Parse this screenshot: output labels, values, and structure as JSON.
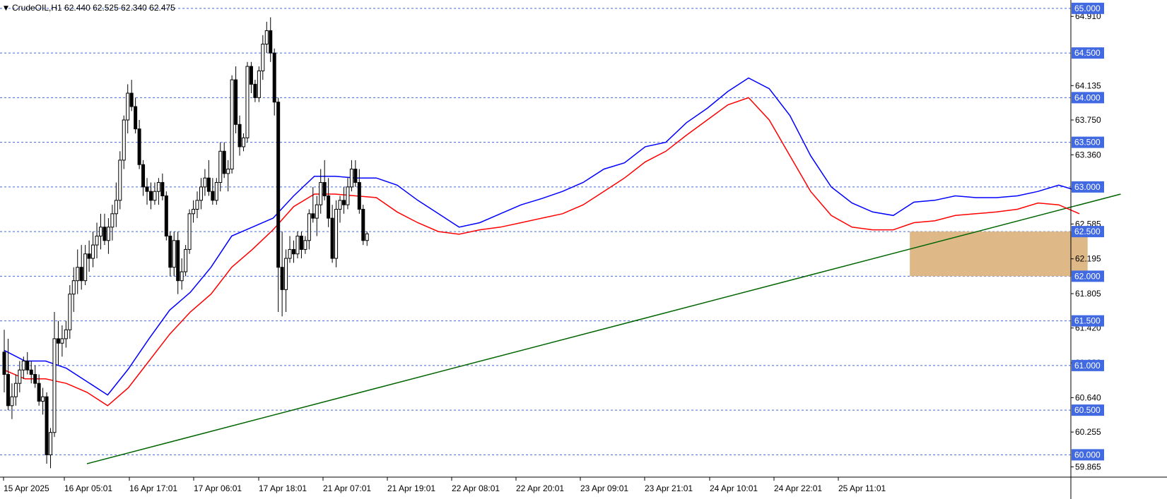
{
  "symbol_header": {
    "marker": "▼",
    "text": "CrudeOIL,H1  62.440 62.525 62.340 62.475"
  },
  "chart_data": {
    "type": "candlestick",
    "symbol": "CrudeOIL",
    "timeframe": "H1",
    "ohlc_last": {
      "open": 62.44,
      "high": 62.525,
      "low": 62.34,
      "close": 62.475
    },
    "ylim": [
      59.75,
      65.07
    ],
    "y_ticks": [
      "64.910",
      "64.135",
      "63.750",
      "63.360",
      "62.585",
      "62.195",
      "61.805",
      "61.420",
      "61.030",
      "60.640",
      "60.255",
      "59.865"
    ],
    "x_ticks": [
      "15 Apr 2025",
      "16 Apr 05:01",
      "16 Apr 17:01",
      "17 Apr 06:01",
      "17 Apr 18:01",
      "21 Apr 07:01",
      "21 Apr 19:01",
      "22 Apr 08:01",
      "22 Apr 20:01",
      "23 Apr 09:01",
      "23 Apr 21:01",
      "24 Apr 10:01",
      "24 Apr 22:01",
      "25 Apr 11:01"
    ],
    "horizontal_levels": [
      65.0,
      64.5,
      64.0,
      63.5,
      63.0,
      62.5,
      62.0,
      61.5,
      61.0,
      60.5,
      60.0
    ],
    "level_labels": [
      "65.000",
      "64.500",
      "64.000",
      "63.500",
      "63.000",
      "62.500",
      "62.000",
      "61.500",
      "61.000",
      "60.500",
      "60.000"
    ],
    "colors": {
      "bull": "#ffffff",
      "bear": "#000000",
      "ema_fast": "#0000ff",
      "ema_slow": "#ff0000",
      "trendline": "#006400",
      "zone": "#deb887",
      "grid": "#4169e1"
    },
    "ema_fast": [
      [
        0,
        61.17
      ],
      [
        5,
        61.05
      ],
      [
        10,
        61.05
      ],
      [
        15,
        60.97
      ],
      [
        20,
        60.82
      ],
      [
        25,
        60.67
      ],
      [
        30,
        60.96
      ],
      [
        35,
        61.3
      ],
      [
        40,
        61.62
      ],
      [
        45,
        61.82
      ],
      [
        50,
        62.1
      ],
      [
        55,
        62.45
      ],
      [
        60,
        62.55
      ],
      [
        65,
        62.65
      ],
      [
        70,
        62.9
      ],
      [
        75,
        63.12
      ],
      [
        80,
        63.12
      ],
      [
        85,
        63.1
      ],
      [
        90,
        63.1
      ],
      [
        95,
        63.02
      ],
      [
        100,
        62.85
      ],
      [
        105,
        62.7
      ],
      [
        110,
        62.55
      ],
      [
        115,
        62.6
      ],
      [
        120,
        62.7
      ],
      [
        125,
        62.8
      ],
      [
        130,
        62.87
      ],
      [
        135,
        62.95
      ],
      [
        140,
        63.05
      ],
      [
        145,
        63.2
      ],
      [
        150,
        63.27
      ],
      [
        155,
        63.45
      ],
      [
        160,
        63.5
      ],
      [
        165,
        63.72
      ],
      [
        170,
        63.88
      ],
      [
        175,
        64.07
      ],
      [
        180,
        64.22
      ],
      [
        185,
        64.1
      ],
      [
        190,
        63.8
      ],
      [
        195,
        63.35
      ],
      [
        200,
        63.0
      ],
      [
        205,
        62.82
      ],
      [
        210,
        62.72
      ],
      [
        215,
        62.68
      ],
      [
        220,
        62.83
      ],
      [
        225,
        62.85
      ],
      [
        230,
        62.9
      ],
      [
        235,
        62.88
      ],
      [
        240,
        62.88
      ],
      [
        245,
        62.9
      ],
      [
        250,
        62.95
      ],
      [
        255,
        63.02
      ],
      [
        260,
        62.95
      ]
    ],
    "ema_slow": [
      [
        0,
        60.95
      ],
      [
        5,
        60.85
      ],
      [
        10,
        60.85
      ],
      [
        15,
        60.8
      ],
      [
        20,
        60.7
      ],
      [
        25,
        60.55
      ],
      [
        30,
        60.75
      ],
      [
        35,
        61.05
      ],
      [
        40,
        61.35
      ],
      [
        45,
        61.6
      ],
      [
        50,
        61.8
      ],
      [
        55,
        62.1
      ],
      [
        60,
        62.3
      ],
      [
        65,
        62.52
      ],
      [
        70,
        62.78
      ],
      [
        75,
        62.92
      ],
      [
        80,
        62.92
      ],
      [
        85,
        62.9
      ],
      [
        90,
        62.88
      ],
      [
        95,
        62.72
      ],
      [
        100,
        62.6
      ],
      [
        105,
        62.5
      ],
      [
        110,
        62.47
      ],
      [
        115,
        62.52
      ],
      [
        120,
        62.55
      ],
      [
        125,
        62.6
      ],
      [
        130,
        62.65
      ],
      [
        135,
        62.7
      ],
      [
        140,
        62.8
      ],
      [
        145,
        62.95
      ],
      [
        150,
        63.1
      ],
      [
        155,
        63.28
      ],
      [
        160,
        63.4
      ],
      [
        165,
        63.58
      ],
      [
        170,
        63.75
      ],
      [
        175,
        63.92
      ],
      [
        180,
        64.0
      ],
      [
        185,
        63.75
      ],
      [
        190,
        63.35
      ],
      [
        195,
        62.95
      ],
      [
        200,
        62.68
      ],
      [
        205,
        62.55
      ],
      [
        210,
        62.52
      ],
      [
        215,
        62.52
      ],
      [
        220,
        62.6
      ],
      [
        225,
        62.62
      ],
      [
        230,
        62.68
      ],
      [
        235,
        62.7
      ],
      [
        240,
        62.72
      ],
      [
        245,
        62.75
      ],
      [
        250,
        62.82
      ],
      [
        255,
        62.8
      ],
      [
        260,
        62.7
      ]
    ],
    "trendline": {
      "start": [
        20,
        59.9
      ],
      "end": [
        270,
        62.92
      ]
    },
    "zone": {
      "x_start": 219,
      "x_end": 262,
      "top": 62.5,
      "bottom": 62.0
    },
    "candles": [
      [
        61.15,
        61.4,
        60.7,
        60.9
      ],
      [
        60.9,
        61.3,
        60.5,
        60.55
      ],
      [
        60.55,
        60.8,
        60.4,
        60.65
      ],
      [
        60.65,
        60.9,
        60.55,
        60.8
      ],
      [
        60.8,
        61.05,
        60.7,
        60.95
      ],
      [
        60.95,
        61.1,
        60.85,
        61.05
      ],
      [
        61.05,
        61.15,
        60.9,
        60.95
      ],
      [
        60.95,
        61.05,
        60.8,
        60.9
      ],
      [
        60.9,
        61.0,
        60.75,
        60.8
      ],
      [
        60.8,
        60.9,
        60.55,
        60.6
      ],
      [
        60.6,
        60.75,
        60.45,
        60.65
      ],
      [
        60.65,
        60.7,
        59.9,
        60.0
      ],
      [
        60.0,
        60.3,
        59.85,
        60.25
      ],
      [
        60.25,
        61.6,
        60.2,
        61.3
      ],
      [
        61.3,
        61.5,
        61.0,
        61.25
      ],
      [
        61.25,
        61.45,
        61.1,
        61.3
      ],
      [
        61.3,
        61.5,
        61.2,
        61.4
      ],
      [
        61.4,
        61.9,
        61.3,
        61.8
      ],
      [
        61.8,
        62.1,
        61.6,
        61.95
      ],
      [
        61.95,
        62.3,
        61.8,
        62.1
      ],
      [
        62.1,
        62.35,
        61.85,
        61.95
      ],
      [
        61.95,
        62.35,
        61.9,
        62.25
      ],
      [
        62.25,
        62.4,
        62.05,
        62.2
      ],
      [
        62.2,
        62.5,
        62.1,
        62.35
      ],
      [
        62.35,
        62.6,
        62.2,
        62.45
      ],
      [
        62.45,
        62.7,
        62.3,
        62.55
      ],
      [
        62.55,
        62.7,
        62.35,
        62.4
      ],
      [
        62.4,
        62.65,
        62.25,
        62.55
      ],
      [
        62.55,
        62.8,
        62.4,
        62.7
      ],
      [
        62.7,
        63.05,
        62.55,
        62.85
      ],
      [
        62.85,
        63.4,
        62.75,
        63.3
      ],
      [
        63.3,
        63.8,
        63.2,
        63.75
      ],
      [
        63.75,
        64.15,
        63.6,
        64.05
      ],
      [
        64.05,
        64.2,
        63.85,
        63.9
      ],
      [
        63.9,
        64.0,
        63.6,
        63.65
      ],
      [
        63.65,
        63.75,
        63.2,
        63.25
      ],
      [
        63.25,
        63.3,
        62.9,
        63.0
      ],
      [
        63.0,
        63.1,
        62.8,
        62.95
      ],
      [
        62.95,
        63.05,
        62.75,
        62.85
      ],
      [
        62.85,
        63.05,
        62.8,
        62.95
      ],
      [
        62.95,
        63.1,
        62.8,
        63.05
      ],
      [
        63.05,
        63.15,
        62.85,
        62.9
      ],
      [
        62.9,
        62.95,
        62.4,
        62.45
      ],
      [
        62.45,
        62.5,
        62.0,
        62.1
      ],
      [
        62.1,
        62.5,
        62.0,
        62.4
      ],
      [
        62.4,
        62.5,
        61.8,
        61.95
      ],
      [
        61.95,
        62.2,
        61.85,
        62.05
      ],
      [
        62.05,
        62.35,
        62.0,
        62.3
      ],
      [
        62.3,
        62.75,
        62.25,
        62.7
      ],
      [
        62.7,
        62.85,
        62.6,
        62.75
      ],
      [
        62.75,
        62.95,
        62.65,
        62.85
      ],
      [
        62.85,
        63.1,
        62.75,
        63.0
      ],
      [
        63.0,
        63.2,
        62.9,
        63.1
      ],
      [
        63.1,
        63.3,
        62.9,
        62.95
      ],
      [
        62.95,
        63.1,
        62.8,
        62.85
      ],
      [
        62.85,
        63.1,
        62.8,
        63.05
      ],
      [
        63.05,
        63.5,
        62.95,
        63.4
      ],
      [
        63.4,
        63.5,
        63.1,
        63.15
      ],
      [
        63.15,
        63.3,
        62.95,
        63.2
      ],
      [
        63.2,
        64.25,
        63.15,
        64.2
      ],
      [
        64.2,
        64.35,
        63.6,
        63.7
      ],
      [
        63.7,
        63.8,
        63.35,
        63.45
      ],
      [
        63.45,
        63.6,
        63.4,
        63.55
      ],
      [
        63.55,
        64.4,
        63.5,
        64.35
      ],
      [
        64.35,
        64.4,
        64.05,
        64.15
      ],
      [
        64.15,
        64.2,
        63.95,
        64.0
      ],
      [
        64.0,
        64.35,
        63.95,
        64.3
      ],
      [
        64.3,
        64.7,
        64.2,
        64.6
      ],
      [
        64.6,
        64.85,
        64.5,
        64.75
      ],
      [
        64.75,
        64.9,
        64.4,
        64.5
      ],
      [
        64.5,
        64.55,
        63.8,
        63.95
      ],
      [
        63.95,
        64.0,
        61.6,
        62.1
      ],
      [
        62.1,
        62.5,
        61.55,
        61.85
      ],
      [
        61.85,
        62.3,
        61.6,
        62.2
      ],
      [
        62.2,
        62.45,
        62.15,
        62.3
      ],
      [
        62.3,
        62.4,
        62.15,
        62.25
      ],
      [
        62.25,
        62.5,
        62.2,
        62.45
      ],
      [
        62.45,
        62.5,
        62.2,
        62.3
      ],
      [
        62.3,
        62.45,
        62.25,
        62.4
      ],
      [
        62.4,
        62.75,
        62.3,
        62.7
      ],
      [
        62.7,
        63.0,
        62.6,
        62.65
      ],
      [
        62.65,
        62.9,
        62.45,
        62.8
      ],
      [
        62.8,
        63.2,
        62.7,
        63.05
      ],
      [
        63.05,
        63.3,
        62.85,
        62.9
      ],
      [
        62.9,
        63.1,
        62.55,
        62.65
      ],
      [
        62.65,
        62.8,
        62.15,
        62.2
      ],
      [
        62.2,
        62.85,
        62.1,
        62.75
      ],
      [
        62.75,
        62.9,
        62.6,
        62.85
      ],
      [
        62.85,
        63.0,
        62.7,
        62.8
      ],
      [
        62.8,
        63.1,
        62.75,
        63.0
      ],
      [
        63.0,
        63.3,
        62.95,
        63.2
      ],
      [
        63.2,
        63.3,
        63.0,
        63.05
      ],
      [
        63.05,
        63.2,
        62.7,
        62.75
      ],
      [
        62.75,
        62.8,
        62.35,
        62.4
      ],
      [
        62.4,
        62.5,
        62.34,
        62.475
      ]
    ]
  }
}
